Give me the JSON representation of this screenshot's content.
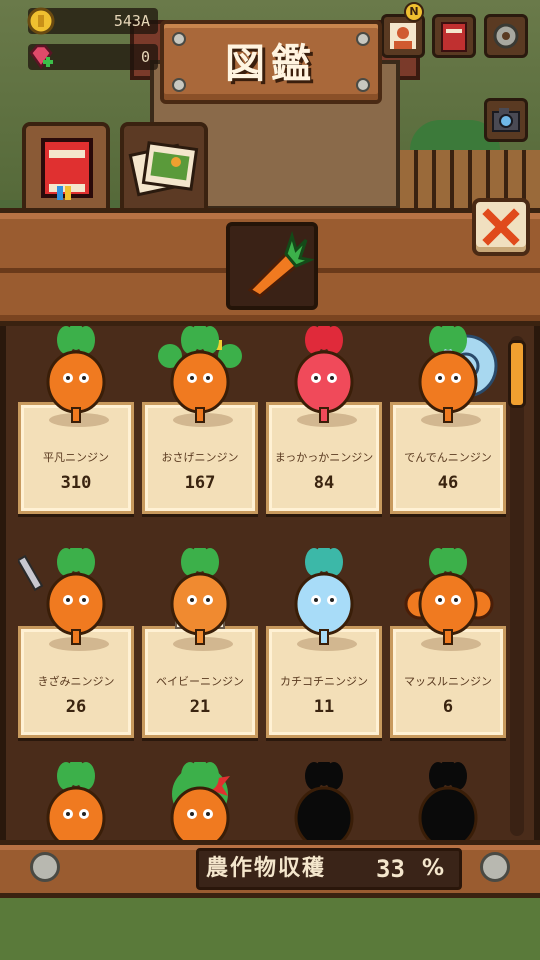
{
  "hud": {
    "coins": "543A",
    "gems": "0"
  },
  "header": {
    "title": "図鑑"
  },
  "top_buttons": {
    "new_badge": "N"
  },
  "tabs": [
    {
      "icon": "book-icon"
    },
    {
      "icon": "photos-icon"
    }
  ],
  "category": {
    "icon": "carrot-icon"
  },
  "colors": {
    "accent": "#f0a030",
    "close_x": "#e04a1c",
    "wood": "#9a5c30",
    "card": "#f3dfb8"
  },
  "collection": {
    "items": [
      {
        "name": "平凡ニンジン",
        "count": "310",
        "variant": "plain"
      },
      {
        "name": "おさげニンジン",
        "count": "167",
        "variant": "pigtail"
      },
      {
        "name": "まっかっかニンジン",
        "count": "84",
        "variant": "red"
      },
      {
        "name": "でんでんニンジン",
        "count": "46",
        "variant": "snail"
      },
      {
        "name": "きざみニンジン",
        "count": "26",
        "variant": "chopped"
      },
      {
        "name": "ベイビーニンジン",
        "count": "21",
        "variant": "baby"
      },
      {
        "name": "カチコチニンジン",
        "count": "11",
        "variant": "ice"
      },
      {
        "name": "マッスルニンジン",
        "count": "6",
        "variant": "muscle"
      }
    ],
    "partial_row": [
      {
        "variant": "lying"
      },
      {
        "variant": "flower"
      },
      {
        "variant": "locked"
      },
      {
        "variant": "locked"
      }
    ]
  },
  "footer": {
    "harvest_label": "農作物収穫",
    "harvest_value": "33",
    "harvest_unit": "%"
  },
  "scroll": {
    "position": 0.0
  }
}
